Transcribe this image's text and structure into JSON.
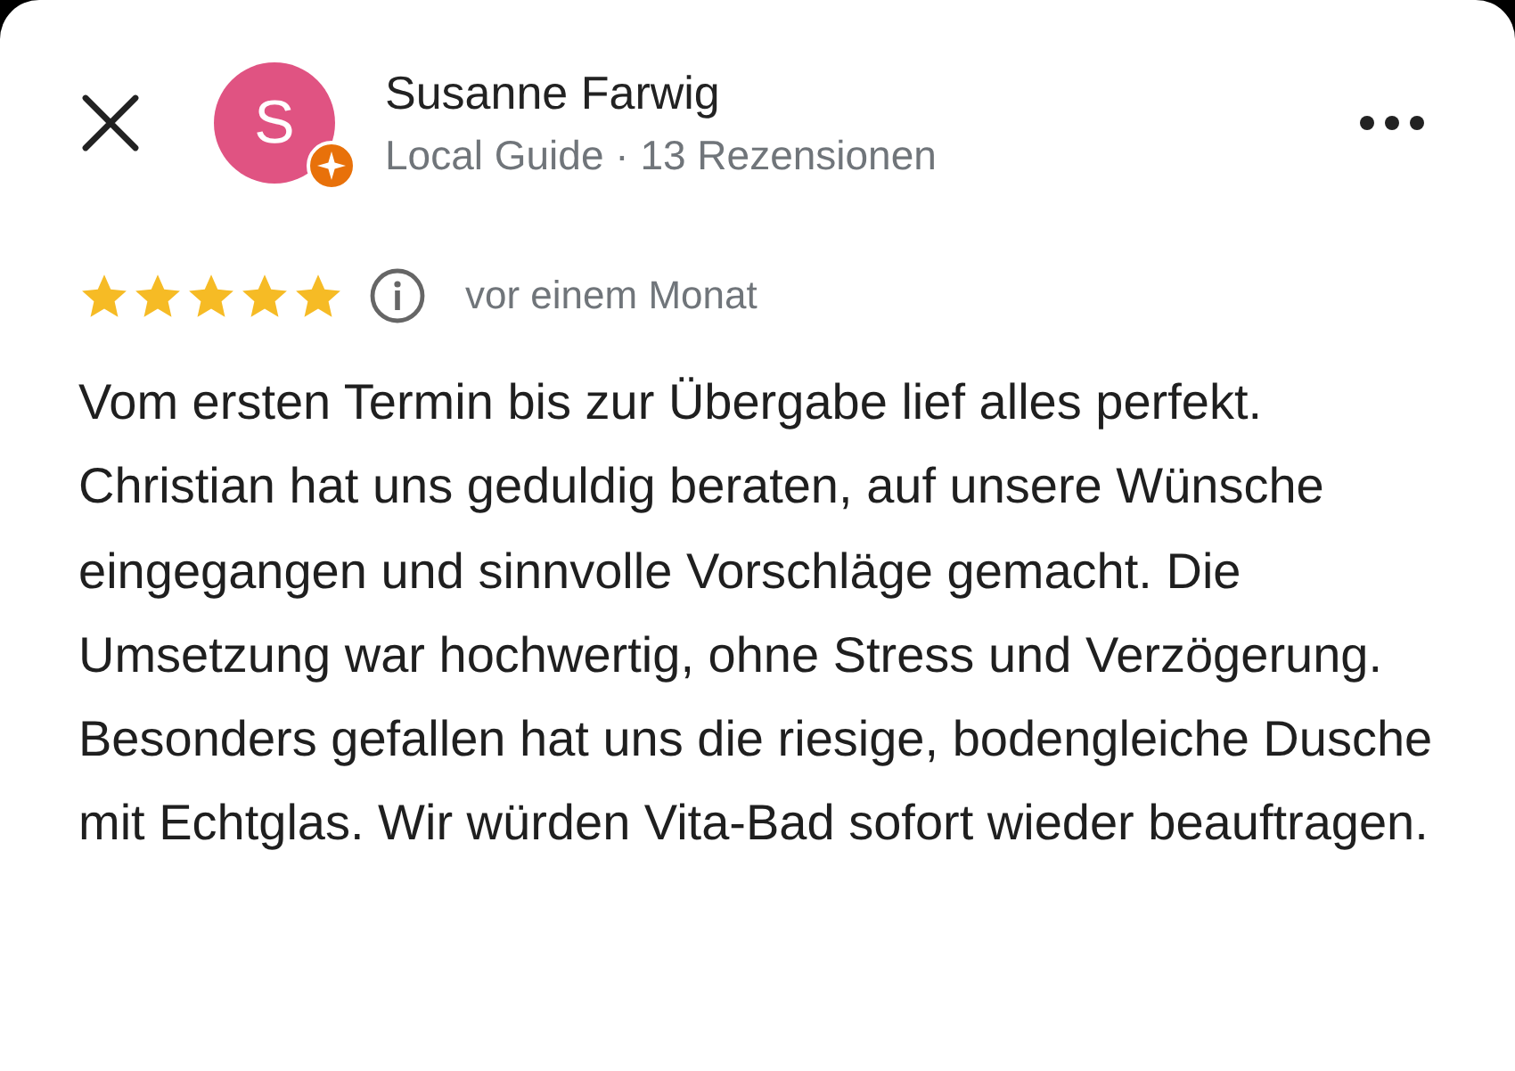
{
  "reviewer": {
    "initial": "S",
    "name": "Susanne Farwig",
    "subtitle": "Local Guide · 13 Rezensionen",
    "local_guide": true
  },
  "review": {
    "stars": 5,
    "time": "vor einem Monat",
    "text": "Vom ersten Termin bis zur Übergabe lief alles perfekt. Christian hat uns geduldig beraten, auf unsere Wünsche eingegangen und sinnvolle Vorschläge gemacht. Die Umsetzung war hochwertig, ohne Stress und Verzögerung. Besonders gefallen hat uns die riesige, bodengleiche Dusche mit Echtglas. Wir würden Vita-Bad sofort wieder beauftragen."
  }
}
